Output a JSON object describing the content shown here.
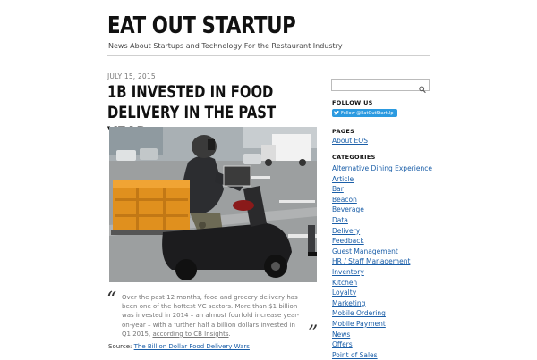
{
  "site": {
    "title": "EAT OUT STARTUP",
    "tagline": "News About Startups and Technology For the Restaurant Industry"
  },
  "post": {
    "date": "JULY 15, 2015",
    "title": "1B INVESTED IN FOOD DELIVERY IN THE PAST YEAR",
    "quote_text": "Over the past 12 months, food and grocery delivery has been one of the hottest VC sectors. More than $1 billion was invested in 2014 – an almost fourfold increase year-on-year – with a further half a billion dollars invested in Q1 2015, ",
    "quote_link": "according to CB Insights",
    "quote_end": ".",
    "source_label": "Source: ",
    "source_link": "The Billion Dollar Food Delivery Wars",
    "quote_open_glyph": "“",
    "quote_close_glyph": "”"
  },
  "sidebar": {
    "search": {
      "value": "",
      "placeholder": ""
    },
    "follow_us_title": "FOLLOW US",
    "twitter_button": "Follow @EatOutStartUp",
    "pages_title": "PAGES",
    "pages": [
      "About EOS"
    ],
    "categories_title": "CATEGORIES",
    "categories": [
      "Alternative Dining Experience",
      "Article",
      "Bar",
      "Beacon",
      "Beverage",
      "Data",
      "Delivery",
      "Feedback",
      "Guest Management",
      "HR / Staff Management",
      "Inventory",
      "Kitchen",
      "Loyalty",
      "Marketing",
      "Mobile Ordering",
      "Mobile Payment",
      "News",
      "Offers",
      "Point of Sales"
    ]
  },
  "icons": {
    "search": "search-icon",
    "twitter": "twitter-bird-icon"
  },
  "colors": {
    "link": "#1a5ea8",
    "twitter": "#2b9ae0"
  }
}
